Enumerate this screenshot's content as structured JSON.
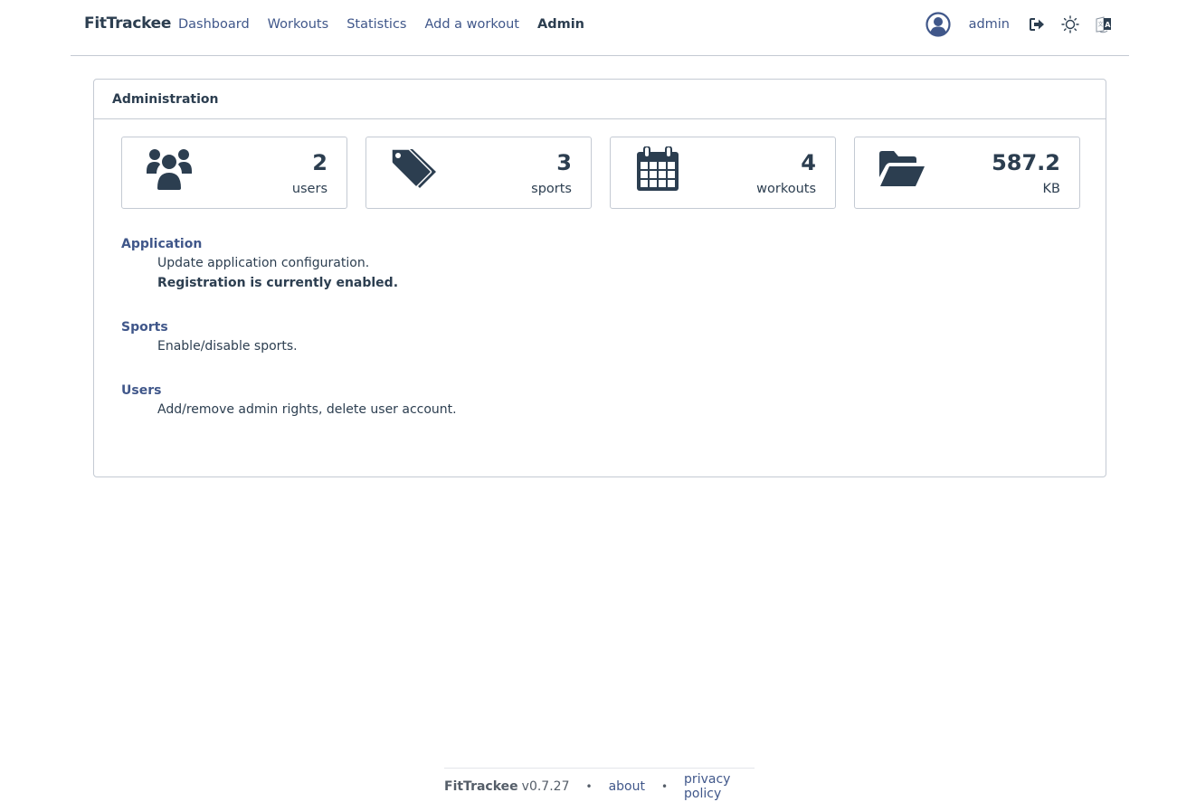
{
  "navbar": {
    "brand": "FitTrackee",
    "links": [
      {
        "label": "Dashboard",
        "active": false
      },
      {
        "label": "Workouts",
        "active": false
      },
      {
        "label": "Statistics",
        "active": false
      },
      {
        "label": "Add a workout",
        "active": false
      },
      {
        "label": "Admin",
        "active": true
      }
    ],
    "user": {
      "name": "admin",
      "avatar_icon": "user-circle-icon"
    },
    "icons": [
      "logout-icon",
      "sun-icon",
      "language-icon"
    ]
  },
  "card": {
    "title": "Administration",
    "stats": [
      {
        "icon": "users-icon",
        "value": "2",
        "label": "users"
      },
      {
        "icon": "tags-icon",
        "value": "3",
        "label": "sports"
      },
      {
        "icon": "calendar-icon",
        "value": "4",
        "label": "workouts"
      },
      {
        "icon": "folder-open-icon",
        "value": "587.2",
        "label": "KB"
      }
    ],
    "sections": [
      {
        "title": "Application",
        "lines": [
          "Update application configuration."
        ],
        "status": "Registration is currently enabled."
      },
      {
        "title": "Sports",
        "lines": [
          "Enable/disable sports."
        ]
      },
      {
        "title": "Users",
        "lines": [
          "Add/remove admin rights, delete user account."
        ]
      }
    ]
  },
  "footer": {
    "brand": "FitTrackee",
    "version": "v0.7.27",
    "separator": "•",
    "links": [
      "about",
      "privacy policy"
    ]
  },
  "colors": {
    "primary_text": "#2c3e50",
    "link": "#40578a",
    "border": "#c4cad3"
  }
}
